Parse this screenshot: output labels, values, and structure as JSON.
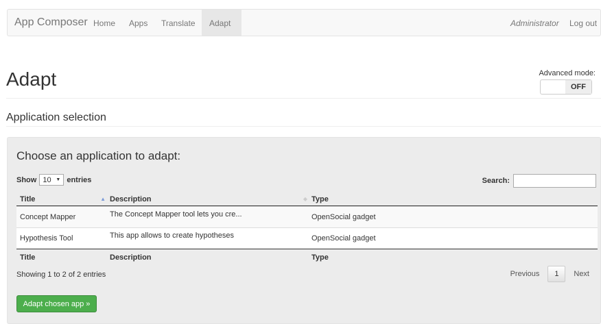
{
  "navbar": {
    "brand": "App Composer",
    "links": [
      "Home",
      "Apps",
      "Translate",
      "Adapt"
    ],
    "active": "Adapt",
    "user": "Administrator",
    "logout": "Log out"
  },
  "page": {
    "title": "Adapt",
    "advanced_mode_label": "Advanced mode:",
    "toggle_state": "OFF",
    "section_title": "Application selection"
  },
  "panel": {
    "title": "Choose an application to adapt:",
    "show_label": "Show",
    "show_value": "10",
    "entries_label": "entries",
    "search_label": "Search:",
    "search_value": "",
    "columns": [
      "Title",
      "Description",
      "Type"
    ],
    "rows": [
      {
        "title": "Concept Mapper",
        "description": "The Concept Mapper tool lets you cre...",
        "type": "OpenSocial gadget"
      },
      {
        "title": "Hypothesis Tool",
        "description": "This app allows to create hypotheses",
        "type": "OpenSocial gadget"
      }
    ],
    "info": "Showing 1 to 2 of 2 entries",
    "pagination": {
      "previous": "Previous",
      "page": "1",
      "next": "Next"
    },
    "button": "Adapt chosen app »"
  },
  "colors": {
    "primary_button": "#4cae4c",
    "navbar_bg": "#f8f8f8",
    "panel_bg": "#ececec"
  }
}
